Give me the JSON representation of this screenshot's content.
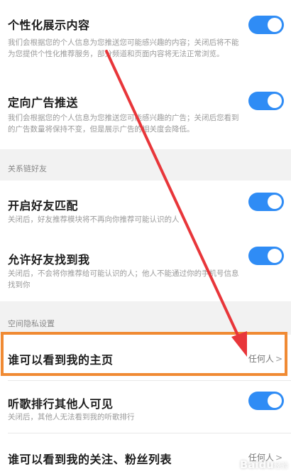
{
  "items": [
    {
      "title": "个性化展示内容",
      "desc": "我们会根据您的个人信息为您推送您可能感兴趣的内容；关闭后将不能为您提供个性化推荐服务，部分频道和页面内容将无法正常浏览。",
      "toggle_on": true
    },
    {
      "title": "定向广告推送",
      "desc": "我们会根据您的个人信息为您推送您可能感兴趣的广告；关闭后您看到的广告数量将保持不变，但是展示广告的相关度会降低。",
      "toggle_on": true
    }
  ],
  "section_friends": "关系链好友",
  "friends_items": [
    {
      "title": "开启好友匹配",
      "desc": "关闭后，好友推荐模块将不再向你推荐可能认识的人",
      "toggle_on": true
    },
    {
      "title": "允许好友找到我",
      "desc": "关闭后，不会将你推荐给可能认识的人；他人不能通过你的手机号信息找到你",
      "toggle_on": true
    }
  ],
  "section_space": "空间隐私设置",
  "who_can_see_home": {
    "title": "谁可以看到我的主页",
    "value": "任何人",
    "chevron": ">"
  },
  "song_rank": {
    "title": "听歌排行其他人可见",
    "desc": "关闭后，其他人无法看到我的听歌排行",
    "toggle_on": true
  },
  "who_can_see_follow": {
    "title": "谁可以看到我的关注、粉丝列表",
    "value": "任何人",
    "chevron": ">"
  },
  "colors": {
    "toggle": "#2f8cf5",
    "highlight": "#f08a33",
    "arrow": "#e8363a"
  },
  "watermark": {
    "brand": "Baidu",
    "sub": "经验"
  }
}
